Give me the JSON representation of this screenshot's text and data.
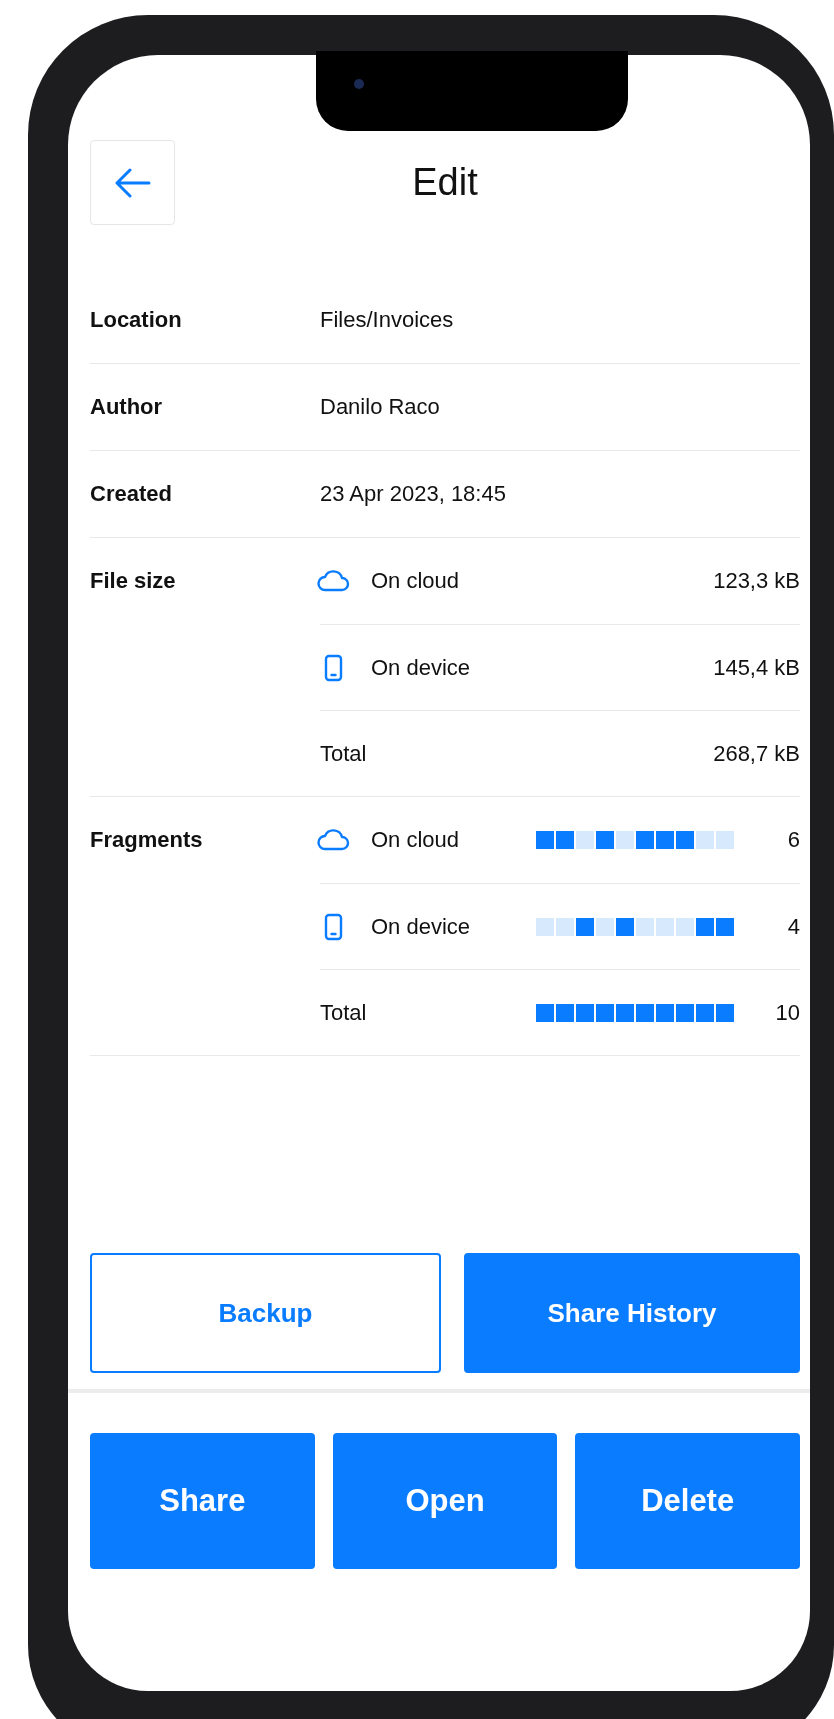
{
  "header": {
    "title": "Edit"
  },
  "rows": [
    {
      "kind": "text",
      "label": "Location",
      "value": "Files/Invoices"
    },
    {
      "kind": "text",
      "label": "Author",
      "value": "Danilo Raco"
    },
    {
      "kind": "text",
      "label": "Created",
      "value": "23 Apr 2023, 18:45"
    },
    {
      "kind": "sizes",
      "label": "File size",
      "items": [
        {
          "kind": "cloud",
          "name": "On cloud",
          "value": "123,3 kB"
        },
        {
          "kind": "device",
          "name": "On device",
          "value": "145,4 kB"
        },
        {
          "kind": "total",
          "name": "Total",
          "value": "268,7 kB"
        }
      ]
    },
    {
      "kind": "fragments",
      "label": "Fragments",
      "items": [
        {
          "kind": "cloud",
          "name": "On cloud",
          "segments": [
            true,
            true,
            false,
            true,
            false,
            true,
            true,
            true,
            false,
            false
          ],
          "count": "6"
        },
        {
          "kind": "device",
          "name": "On device",
          "segments": [
            false,
            false,
            true,
            false,
            true,
            false,
            false,
            false,
            true,
            true
          ],
          "count": "4"
        },
        {
          "kind": "total",
          "name": "Total",
          "segments": [
            true,
            true,
            true,
            true,
            true,
            true,
            true,
            true,
            true,
            true
          ],
          "count": "10"
        }
      ]
    }
  ],
  "actions": [
    {
      "label": "Backup",
      "primary": false
    },
    {
      "label": "Share History",
      "primary": true
    }
  ],
  "bottom_actions": [
    "Share",
    "Open",
    "Delete"
  ]
}
